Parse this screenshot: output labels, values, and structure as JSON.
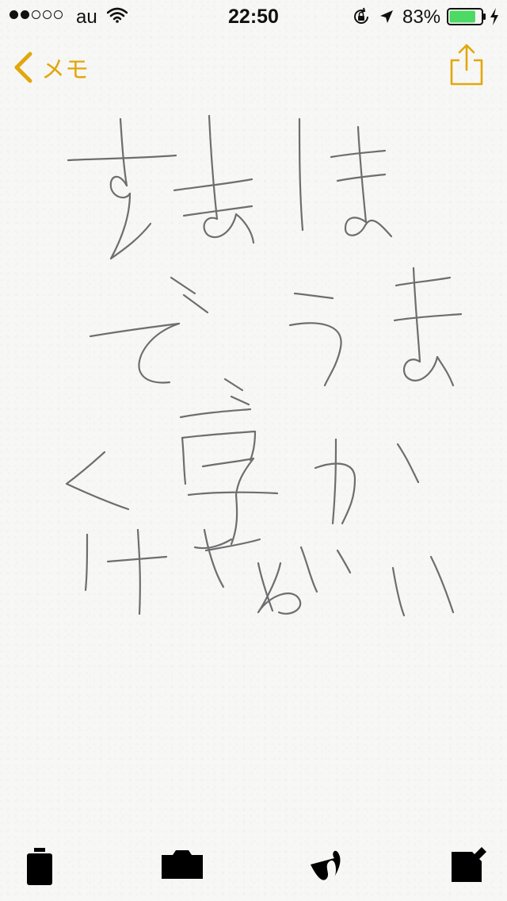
{
  "status_bar": {
    "carrier": "au",
    "time": "22:50",
    "battery_percent": "83%",
    "battery_level": 0.83,
    "signal_strength": 2,
    "signal_total": 5
  },
  "nav": {
    "back_label": "メモ"
  },
  "icons": {
    "back": "chevron-left-icon",
    "share": "share-icon",
    "trash": "trash-icon",
    "camera": "camera-icon",
    "sketch": "sketch-icon",
    "compose": "compose-icon"
  },
  "colors": {
    "accent": "#e2a70d",
    "ink": "#6e6e70",
    "battery": "#4cd964",
    "paper": "#f7f7f5"
  }
}
